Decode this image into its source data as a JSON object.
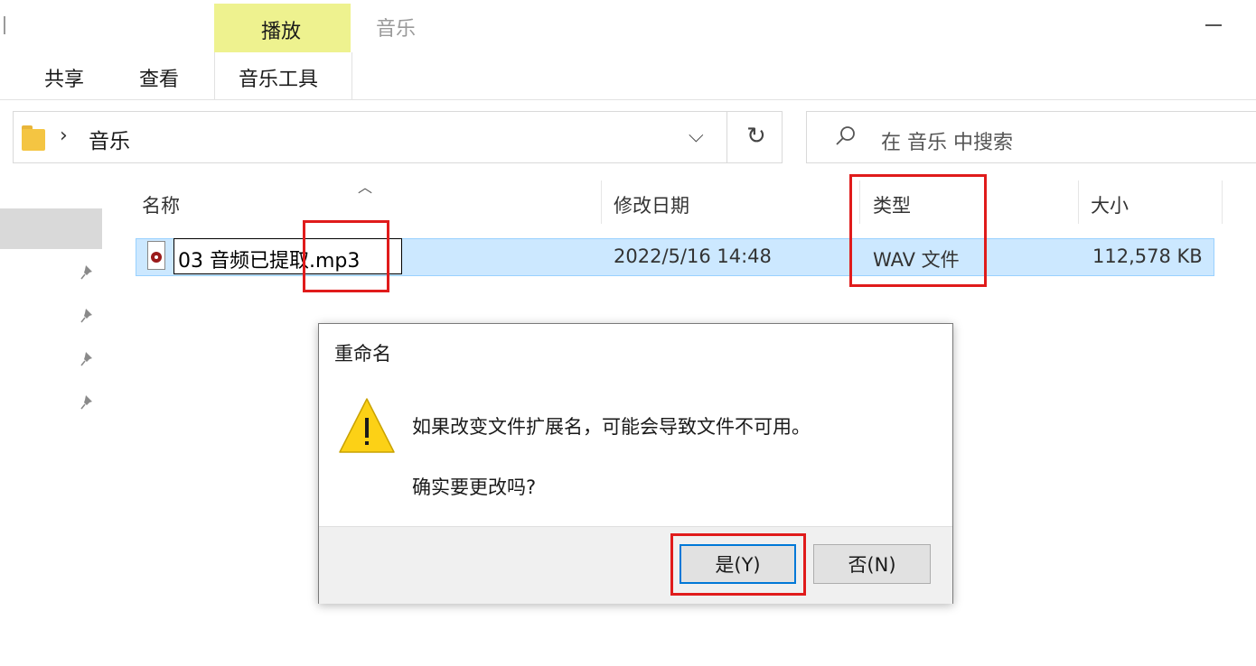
{
  "ribbon": {
    "context_tab_label": "播放",
    "context_group_label": "音乐",
    "tabs": [
      {
        "label": "共享"
      },
      {
        "label": "查看"
      },
      {
        "label": "音乐工具"
      }
    ]
  },
  "address": {
    "crumb": "音乐",
    "search_placeholder": "在 音乐 中搜索"
  },
  "columns": {
    "name": "名称",
    "date": "修改日期",
    "type": "类型",
    "size": "大小"
  },
  "file": {
    "name_editing": "03 音频已提取.mp3",
    "date": "2022/5/16 14:48",
    "type": "WAV 文件",
    "size": "112,578 KB"
  },
  "dialog": {
    "title": "重命名",
    "message1": "如果改变文件扩展名，可能会导致文件不可用。",
    "message2": "确实要更改吗?",
    "yes_label": "是(Y)",
    "no_label": "否(N)"
  },
  "colors": {
    "annotation": "#e01b1b",
    "selection": "#cce8ff",
    "context_tab": "#eef28f",
    "focus": "#0078d7"
  },
  "icons": [
    "folder-icon",
    "chevron-right-icon",
    "chevron-down-icon",
    "refresh-icon",
    "search-icon",
    "pin-icon",
    "sort-up-icon",
    "audio-file-icon",
    "warning-icon",
    "minimize-icon"
  ]
}
